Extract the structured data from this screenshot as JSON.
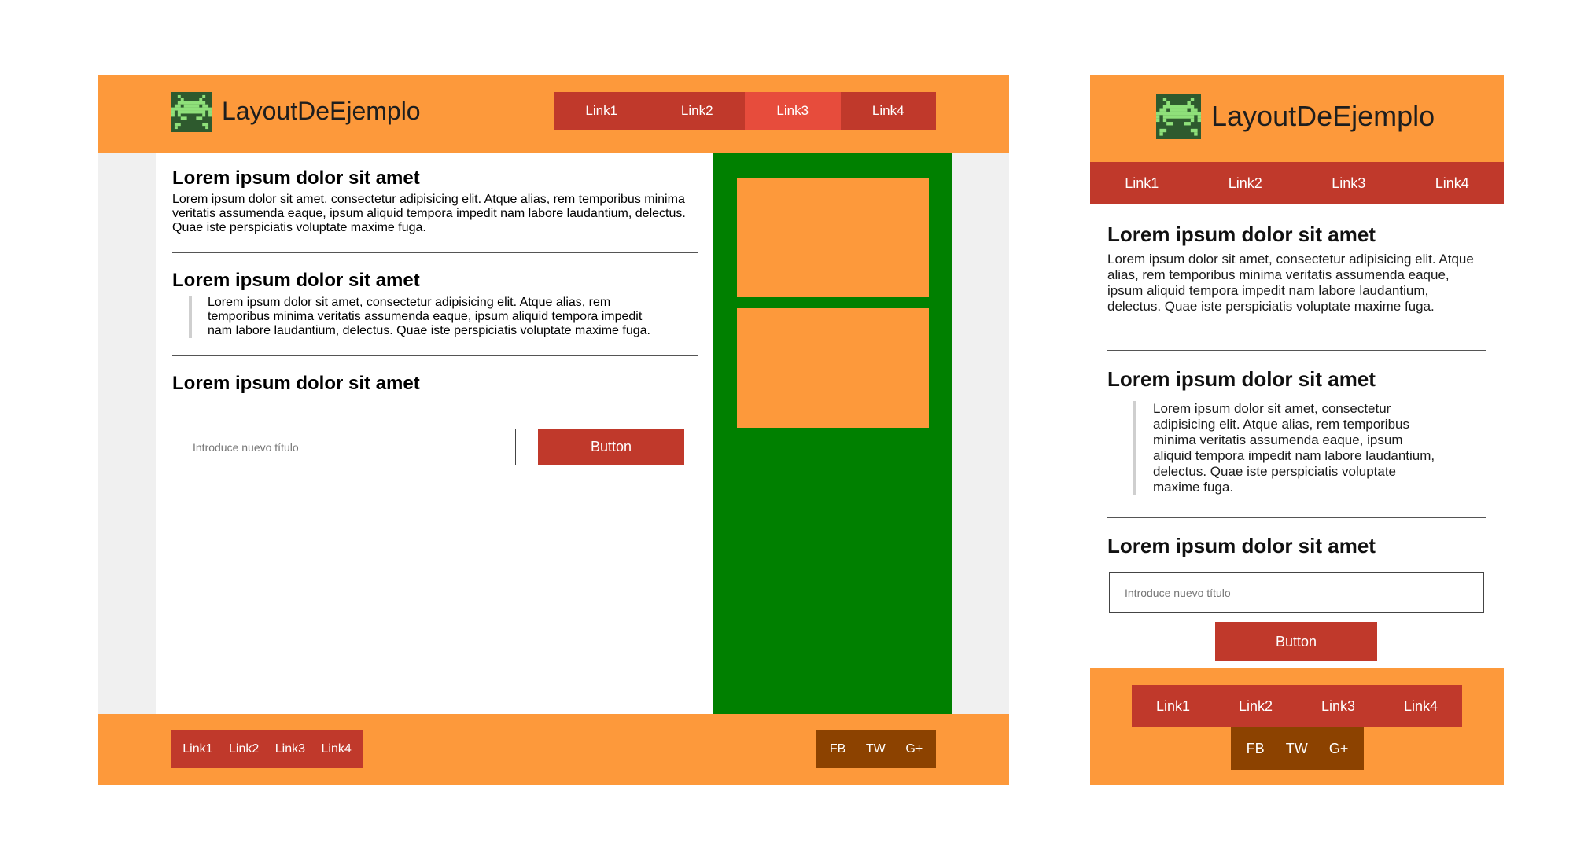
{
  "colors": {
    "header_orange": "#fd993b",
    "nav_red": "#c0392b",
    "nav_active": "#e74c3c",
    "sidebar_green": "#008000",
    "social_brown": "#8c4200",
    "logo_dark": "#2e5a2e",
    "logo_light": "#8fe07a"
  },
  "brand": {
    "name": "LayoutDeEjemplo",
    "logo_icon": "space-invader-icon"
  },
  "nav": {
    "links": [
      "Link1",
      "Link2",
      "Link3",
      "Link4"
    ],
    "active_index": 2
  },
  "content": {
    "heading": "Lorem ipsum dolor sit amet",
    "paragraph": "Lorem ipsum dolor sit amet, consectetur adipisicing elit. Atque alias, rem temporibus minima veritatis assumenda eaque, ipsum aliquid tempora impedit nam labore laudantium, delectus. Quae iste perspiciatis voluptate maxime fuga.",
    "input_placeholder": "Introduce nuevo título",
    "button_label": "Button"
  },
  "footer": {
    "links": [
      "Link1",
      "Link2",
      "Link3",
      "Link4"
    ],
    "social": [
      "FB",
      "TW",
      "G+"
    ]
  }
}
